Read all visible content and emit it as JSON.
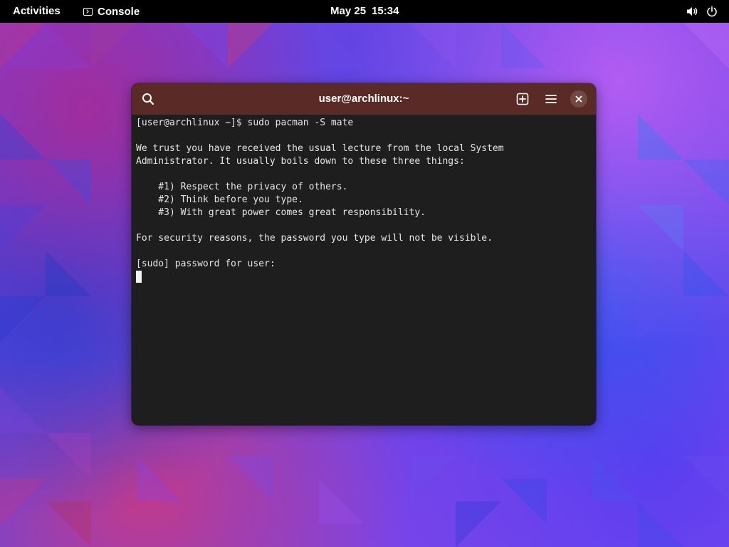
{
  "topbar": {
    "activities_label": "Activities",
    "app_name": "Console",
    "app_icon": "terminal-icon",
    "date": "May 25",
    "time": "15:34",
    "tray_icons": [
      "volume-icon",
      "power-icon"
    ]
  },
  "window": {
    "title": "user@archlinux:~",
    "header_icons": [
      "search-icon",
      "new-tab-icon",
      "menu-icon",
      "close-icon"
    ],
    "colors": {
      "headerbar": "#5a2a26",
      "terminal_bg": "#1e1e1e",
      "terminal_fg": "#e6e6e6"
    }
  },
  "terminal": {
    "lines": [
      "[user@archlinux ~]$ sudo pacman -S mate",
      "",
      "We trust you have received the usual lecture from the local System",
      "Administrator. It usually boils down to these three things:",
      "",
      "    #1) Respect the privacy of others.",
      "    #2) Think before you type.",
      "    #3) With great power comes great responsibility.",
      "",
      "For security reasons, the password you type will not be visible.",
      "",
      "[sudo] password for user:"
    ]
  }
}
